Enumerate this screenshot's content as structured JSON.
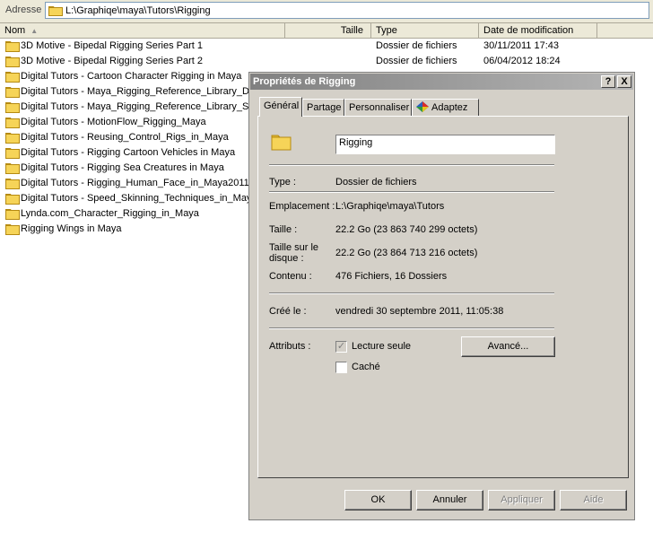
{
  "address_bar": {
    "label": "Adresse",
    "path": "L:\\Graphiqe\\maya\\Tutors\\Rigging"
  },
  "columns": {
    "name": "Nom",
    "size": "Taille",
    "type": "Type",
    "date": "Date de modification"
  },
  "files": [
    {
      "name": "3D Motive - Bipedal Rigging Series Part 1",
      "type": "Dossier de fichiers",
      "date": "30/11/2011 17:43"
    },
    {
      "name": "3D Motive - Bipedal Rigging Series Part 2",
      "type": "Dossier de fichiers",
      "date": "06/04/2012 18:24"
    },
    {
      "name": "Digital Tutors - Cartoon Character Rigging in Maya"
    },
    {
      "name": "Digital Tutors - Maya_Rigging_Reference_Library_De"
    },
    {
      "name": "Digital Tutors - Maya_Rigging_Reference_Library_Sk"
    },
    {
      "name": "Digital Tutors - MotionFlow_Rigging_Maya"
    },
    {
      "name": "Digital Tutors - Reusing_Control_Rigs_in_Maya"
    },
    {
      "name": "Digital Tutors - Rigging Cartoon Vehicles in Maya"
    },
    {
      "name": "Digital Tutors - Rigging Sea Creatures in Maya"
    },
    {
      "name": "Digital Tutors - Rigging_Human_Face_in_Maya2011"
    },
    {
      "name": "Digital Tutors - Speed_Skinning_Techniques_in_Maya"
    },
    {
      "name": "Lynda.com_Character_Rigging_in_Maya"
    },
    {
      "name": "Rigging Wings in Maya"
    }
  ],
  "dialog": {
    "title": "Propriétés de Rigging",
    "help_label": "?",
    "close_label": "X",
    "tabs": [
      "Général",
      "Partage",
      "Personnaliser",
      "Adaptez"
    ],
    "folder_name": "Rigging",
    "type_label": "Type :",
    "type_value": "Dossier de fichiers",
    "location_label": "Emplacement :",
    "location_value": "L:\\Graphiqe\\maya\\Tutors",
    "size_label": "Taille :",
    "size_value": "22.2 Go (23 863 740 299 octets)",
    "disk_size_label_1": "Taille sur le",
    "disk_size_label_2": "disque :",
    "disk_size_value": "22.2 Go (23 864 713 216 octets)",
    "contents_label": "Contenu :",
    "contents_value": "476 Fichiers, 16 Dossiers",
    "created_label": "Créé le :",
    "created_value": "vendredi 30 septembre 2011, 11:05:38",
    "attributes_label": "Attributs :",
    "readonly_label": "Lecture seule",
    "readonly_checked": true,
    "hidden_label": "Caché",
    "hidden_checked": false,
    "advanced_button": "Avancé...",
    "ok_button": "OK",
    "cancel_button": "Annuler",
    "apply_button": "Appliquer",
    "help_button": "Aide"
  }
}
